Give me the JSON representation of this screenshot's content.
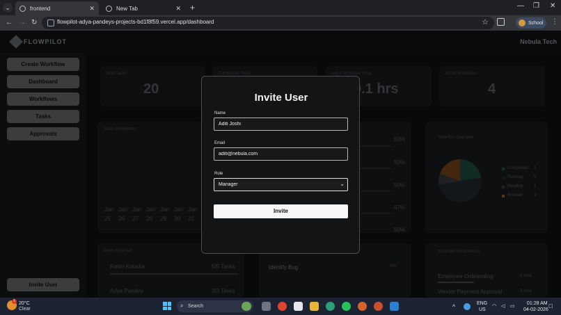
{
  "browser": {
    "tabs": [
      {
        "label": "frontend",
        "active": true
      },
      {
        "label": "New Tab",
        "active": false
      }
    ],
    "new_tab_symbol": "+",
    "url": "flowpilot-adya-pandeys-projects-bd1f8f59.vercel.app/dashboard",
    "profile_label": "School",
    "icons": [
      "tab-list-icon",
      "back-icon",
      "forward-icon",
      "reload-icon",
      "site-info-icon",
      "bookmark-star-icon",
      "extensions-icon",
      "menu-icon"
    ]
  },
  "app": {
    "brand": "FLOWPILOT",
    "org_name": "Nebula Tech",
    "sidebar": {
      "items": [
        {
          "label": "Create Workflow"
        },
        {
          "label": "Dashboard"
        },
        {
          "label": "Workflows"
        },
        {
          "label": "Tasks"
        },
        {
          "label": "Approvals"
        }
      ],
      "invite_label": "Invite User"
    },
    "stats": [
      {
        "label": "Total Tasks",
        "value": "20"
      },
      {
        "label": "Completed Today",
        "value": ""
      },
      {
        "label": "Avg Completion Time",
        "value": "0.1 hrs"
      },
      {
        "label": "Active Workflows",
        "value": "4"
      }
    ],
    "tasks_completed": {
      "title": "Tasks Completed",
      "days": [
        {
          "month": "Jan",
          "day": "25"
        },
        {
          "month": "Jan",
          "day": "26"
        },
        {
          "month": "Jan",
          "day": "27"
        },
        {
          "month": "Jan",
          "day": "28"
        },
        {
          "month": "Jan",
          "day": "29"
        },
        {
          "month": "Jan",
          "day": "30"
        },
        {
          "month": "Jan",
          "day": "31"
        }
      ]
    },
    "progress_percents": [
      "50%",
      "50%",
      "50%",
      "67%",
      "50%"
    ],
    "workflow_overview": {
      "title": "Workflow Overview",
      "legend": [
        {
          "label": "Completed",
          "count": "2",
          "color": "#1f5d4d"
        },
        {
          "label": "Running",
          "count": "5",
          "color": "#2a2d31"
        },
        {
          "label": "Pending",
          "count": "1",
          "color": "#3c3f44"
        },
        {
          "label": "Blocked",
          "count": "2",
          "color": "#a8611f"
        }
      ]
    },
    "team_workload": {
      "title": "Team Workload",
      "members": [
        {
          "name": "Rashi Kotadia",
          "tasks": "5/5 Tasks"
        },
        {
          "name": "Adya Pandey",
          "tasks": "3/3 Tasks"
        }
      ]
    },
    "task_card": {
      "title": "Identify Bug",
      "badge": "44h"
    },
    "workflow_performance": {
      "title": "Workflow Performance",
      "rows": [
        {
          "name": "Employee Onboarding",
          "runs": "5 runs"
        },
        {
          "name": "Vendor Payment Approval",
          "runs": "3 runs"
        }
      ]
    }
  },
  "modal": {
    "title": "Invite User",
    "name_label": "Name",
    "name_value": "Aditi Joshi",
    "email_label": "Email",
    "email_value": "aditi@nebula.com",
    "role_label": "Role",
    "role_value": "Manager",
    "submit_label": "Invite"
  },
  "taskbar": {
    "weather_temp": "20°C",
    "weather_condition": "Clear",
    "weather_badge": "1",
    "search_label": "Search",
    "lang_line1": "ENG",
    "lang_line2": "US",
    "time": "01:28 AM",
    "date": "04-02-2026"
  }
}
